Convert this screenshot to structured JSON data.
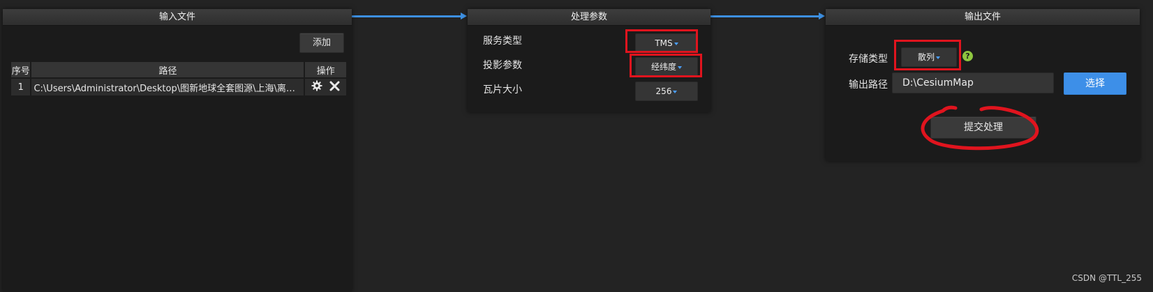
{
  "input_panel": {
    "title": "输入文件",
    "add_label": "添加",
    "table": {
      "headers": [
        "序号",
        "路径",
        "操作"
      ],
      "rows": [
        {
          "index": "1",
          "path": "C:\\Users\\Administrator\\Desktop\\图新地球全套图源\\上海\\离线影像"
        }
      ]
    }
  },
  "params_panel": {
    "title": "处理参数",
    "service_type": {
      "label": "服务类型",
      "value": "TMS"
    },
    "projection": {
      "label": "投影参数",
      "value": "经纬度"
    },
    "tile_size": {
      "label": "瓦片大小",
      "value": "256"
    }
  },
  "output_panel": {
    "title": "输出文件",
    "storage_type": {
      "label": "存储类型",
      "value": "散列"
    },
    "output_path": {
      "label": "输出路径",
      "value": "D:\\CesiumMap"
    },
    "choose_label": "选择",
    "submit_label": "提交处理"
  },
  "watermark": "CSDN @TTL_255",
  "colors": {
    "accent_blue": "#3d8fe8",
    "annotation_red": "#e0141e",
    "help_green": "#8ec63f",
    "background": "#232323"
  },
  "icons": [
    "gear-icon",
    "close-icon",
    "caret-down-icon",
    "help-icon"
  ]
}
